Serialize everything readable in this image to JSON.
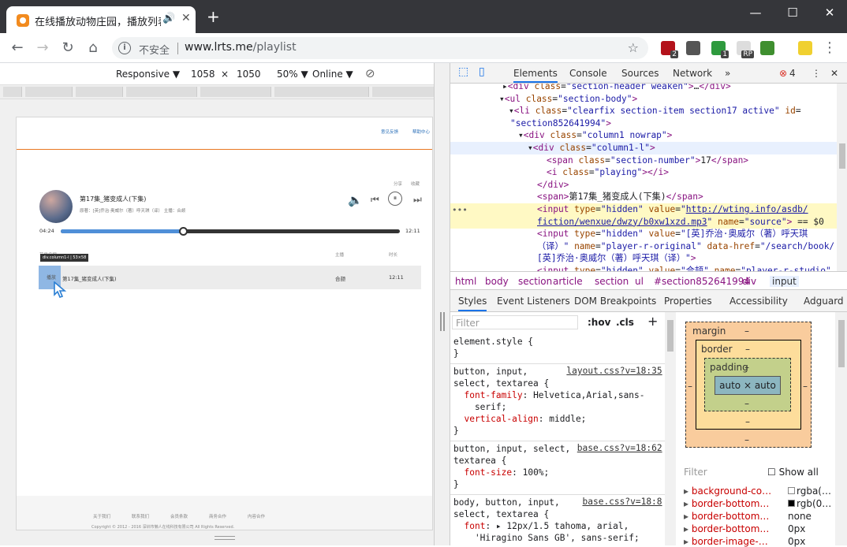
{
  "browser": {
    "tab_title": "在线播放动物庄园，播放列表",
    "new_tab_glyph": "+",
    "window_min": "—",
    "window_max": "☐",
    "window_close": "✕",
    "security_label": "不安全",
    "url_host": "www.lrts.me",
    "url_path": "/playlist",
    "icons": [
      "back-icon",
      "forward-icon",
      "reload-icon",
      "home-icon",
      "info-icon",
      "star-icon"
    ],
    "extensions": [
      {
        "name": "ublock-extension-icon",
        "color": "#b3121b",
        "badge": "2"
      },
      {
        "name": "extension-icon-2",
        "color": "#555555",
        "badge": ""
      },
      {
        "name": "shield-extension-icon",
        "color": "#2e9a3e",
        "badge": "1"
      },
      {
        "name": "rp-extension-icon",
        "color": "#dddddd",
        "badge": "RP"
      },
      {
        "name": "download-extension-icon",
        "color": "#3f8f2f",
        "badge": ""
      },
      {
        "name": "bulb-extension-icon",
        "color": "#f0d030",
        "badge": ""
      }
    ]
  },
  "device_toolbar": {
    "mode": "Responsive ▼",
    "width": "1058",
    "times": "×",
    "height": "1050",
    "zoom": "50% ▼",
    "network": "Online ▼"
  },
  "page": {
    "toplinks": [
      "意见反馈",
      "帮助中心"
    ],
    "share": "分享",
    "fav": "收藏",
    "episode_title": "第17集_猪变成人(下集)",
    "episode_meta": "原著：[英]乔治·奥威尔（著）呼天琪（译）     主播：合颉",
    "time_current": "04:24",
    "time_total": "12:11",
    "progress_fraction": 0.361,
    "col_title": "节目名称",
    "col_host": "主播",
    "col_duration": "时长",
    "tooltip": "div.column1-l | 53×58",
    "row": {
      "num": "播放",
      "name": "第17集_猪变成人(下集)",
      "host": "合颉",
      "duration": "12:11"
    },
    "footer_links": [
      "关于我们",
      "联系我们",
      "会员条款",
      "商务合作",
      "内容合作"
    ],
    "copyright": "Copyright © 2012 - 2016 深圳市懒人在线科技有限公司 All Rights Reserved."
  },
  "devtools": {
    "tabs": [
      "Elements",
      "Console",
      "Sources",
      "Network",
      "»"
    ],
    "error_count": "4",
    "dom_lines": [
      {
        "indent": 66,
        "html": "▸<span class='tag'>&lt;div</span> <span class='attr'>class</span>=<span class='val'>\"section-header weaken\"</span><span class='tag'>&gt;</span>…<span class='tag'>&lt;/div&gt;</span>"
      },
      {
        "indent": 62,
        "html": "▾<span class='tag'>&lt;ul</span> <span class='attr'>class</span>=<span class='val'>\"section-body\"</span><span class='tag'>&gt;</span>"
      },
      {
        "indent": 74,
        "html": "▾<span class='tag'>&lt;li</span> <span class='attr'>class</span>=<span class='val'>\"clearfix section-item section17 active\"</span> <span class='attr'>id</span>="
      },
      {
        "indent": 76,
        "html": "<span class='val'>\"section852641994\"</span><span class='tag'>&gt;</span>"
      },
      {
        "indent": 86,
        "html": "▾<span class='tag'>&lt;div</span> <span class='attr'>class</span>=<span class='val'>\"column1 nowrap\"</span><span class='tag'>&gt;</span>"
      },
      {
        "indent": 98,
        "html": "▾<span class='tag'>&lt;div</span> <span class='attr'>class</span>=<span class='val'>\"column1-l\"</span><span class='tag'>&gt;</span>"
      },
      {
        "indent": 122,
        "html": "<span class='tag'>&lt;span</span> <span class='attr'>class</span>=<span class='val'>\"section-number\"</span><span class='tag'>&gt;</span>17<span class='tag'>&lt;/span&gt;</span>"
      },
      {
        "indent": 122,
        "html": "<span class='tag'>&lt;i</span> <span class='attr'>class</span>=<span class='val'>\"playing\"</span><span class='tag'>&gt;&lt;/i&gt;</span>"
      },
      {
        "indent": 110,
        "html": "<span class='tag'>&lt;/div&gt;</span>"
      },
      {
        "indent": 110,
        "html": "<span class='tag'>&lt;span&gt;</span>第17集_猪变成人(下集)<span class='tag'>&lt;/span&gt;</span>"
      },
      {
        "indent": 110,
        "html": "<span class='tag'>&lt;input</span> <span class='attr'>type</span>=<span class='val'>\"hidden\"</span> <span class='attr'>value</span>=<span class='val'>\"<u>http://wting.info/asdb/</u></span>"
      },
      {
        "indent": 110,
        "html": "<span class='val'><u>fiction/wenxue/dwzy/b0xw1xzd.mp3</u>\"</span> <span class='attr'>name</span>=<span class='val'>\"source\"</span><span class='tag'>&gt;</span> == $0"
      },
      {
        "indent": 110,
        "html": "<span class='tag'>&lt;input</span> <span class='attr'>type</span>=<span class='val'>\"hidden\"</span> <span class='attr'>value</span>=<span class='val'>\"[英]乔治·奥威尔（著）呼天琪</span>"
      },
      {
        "indent": 110,
        "html": "<span class='val'>（译）\"</span> <span class='attr'>name</span>=<span class='val'>\"player-r-original\"</span> <span class='attr'>data-href</span>=<span class='val'>\"/search/book/</span>"
      },
      {
        "indent": 110,
        "html": "<span class='val'>[英]乔治·奥威尔（著）呼天琪（译）\"</span><span class='tag'>&gt;</span>"
      },
      {
        "indent": 110,
        "html": "<span class='tag'>&lt;input</span> <span class='attr'>type</span>=<span class='val'>\"hidden\"</span> <span class='attr'>value</span>=<span class='val'>\"合颉\"</span> <span class='attr'>name</span>=<span class='val'>\"player-r-studio\"</span>"
      }
    ],
    "breadcrumbs": [
      "html",
      "body",
      "section",
      "article",
      "section",
      "ul",
      "#section852641994",
      "div",
      "input"
    ],
    "subtabs": [
      "Styles",
      "Event Listeners",
      "DOM Breakpoints",
      "Properties",
      "Accessibility",
      "Adguard"
    ],
    "filter_placeholder": "Filter",
    "hov": ":hov",
    "cls": ".cls",
    "plus": "+",
    "style_rules": [
      {
        "lines": [
          "element.style {",
          "}"
        ],
        "link": ""
      },
      {
        "lines": [
          "button, input,",
          "select, textarea {",
          "  font-family: Helvetica,Arial,sans-",
          "    serif;",
          "  vertical-align: middle;",
          "}"
        ],
        "link": "layout.css?v=18:35"
      },
      {
        "lines": [
          "button, input, select,",
          "textarea {",
          "  font-size: 100%;",
          "}"
        ],
        "link": "base.css?v=18:62"
      },
      {
        "lines": [
          "body, button, input,",
          "select, textarea {",
          "  font: ▸ 12px/1.5 tahoma, arial,",
          "    'Hiragino Sans GB', sans-serif;",
          "}"
        ],
        "link": "base.css?v=18:8"
      }
    ],
    "boxmodel": {
      "margin_label": "margin",
      "border_label": "border",
      "padding_label": "padding",
      "content": "auto × auto",
      "dash": "–"
    },
    "computed_filter": "Filter",
    "show_all": "Show all",
    "computed": [
      {
        "prop": "background-co…",
        "val": "rgba(…",
        "swatch": "#ffffff"
      },
      {
        "prop": "border-bottom…",
        "val": "rgb(0…",
        "swatch": "#000000"
      },
      {
        "prop": "border-bottom…",
        "val": "none",
        "swatch": ""
      },
      {
        "prop": "border-bottom…",
        "val": "0px",
        "swatch": ""
      },
      {
        "prop": "border-image-…",
        "val": "0px",
        "swatch": ""
      }
    ]
  }
}
